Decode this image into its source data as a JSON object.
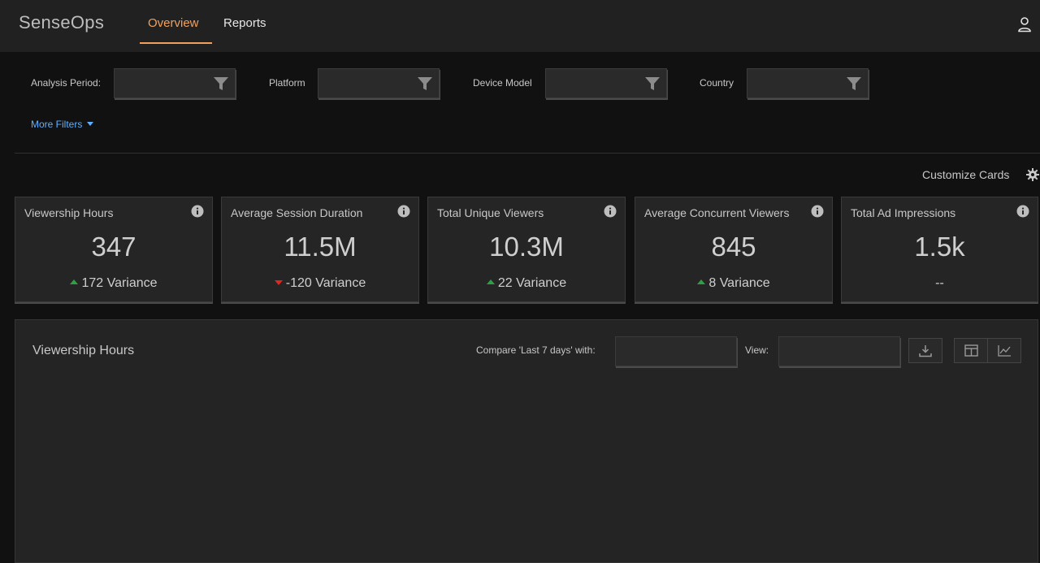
{
  "app": {
    "title": "SenseOps"
  },
  "nav": {
    "tabs": [
      {
        "label": "Overview",
        "active": true
      },
      {
        "label": "Reports",
        "active": false
      }
    ]
  },
  "filters": {
    "analysis_period": {
      "label": "Analysis Period:",
      "value": ""
    },
    "platform": {
      "label": "Platform",
      "value": ""
    },
    "device_model": {
      "label": "Device Model",
      "value": ""
    },
    "country": {
      "label": "Country",
      "value": ""
    },
    "more_filters": "More Filters"
  },
  "customize_cards": "Customize Cards",
  "cards": [
    {
      "title": "Viewership Hours",
      "value": "347",
      "variance": "172 Variance",
      "trend": "up"
    },
    {
      "title": "Average Session Duration",
      "value": "11.5M",
      "variance": "-120 Variance",
      "trend": "down"
    },
    {
      "title": "Total Unique Viewers",
      "value": "10.3M",
      "variance": "22 Variance",
      "trend": "up"
    },
    {
      "title": "Average Concurrent Viewers",
      "value": "845",
      "variance": "8 Variance",
      "trend": "up"
    },
    {
      "title": "Total Ad Impressions",
      "value": "1.5k",
      "variance": "--",
      "trend": "none"
    }
  ],
  "panel": {
    "title": "Viewership Hours",
    "compare_label": "Compare 'Last 7 days' with:",
    "compare_value": "",
    "view_label": "View:",
    "view_value": ""
  },
  "colors": {
    "accent": "#f0a15e",
    "link": "#5fb0ff",
    "up": "#2ea043",
    "down": "#e0261f"
  }
}
